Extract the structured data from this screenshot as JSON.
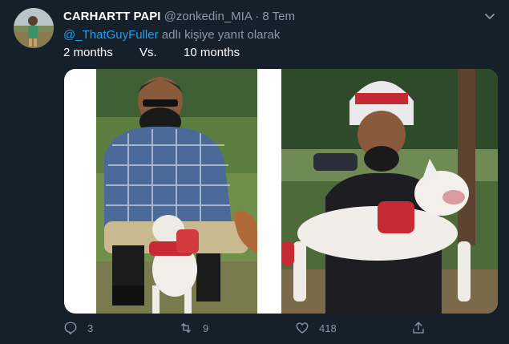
{
  "tweet": {
    "display_name": "CARHARTT PAPI",
    "handle": "@zonkedin_MIA",
    "separator": "·",
    "date": "8 Tem",
    "reply_to_handle": "@_ThatGuyFuller",
    "reply_to_suffix": " adlı kişiye yanıt olarak",
    "text": "2 months        Vs.        10 months"
  },
  "actions": {
    "reply_count": "3",
    "retweet_count": "9",
    "like_count": "418"
  },
  "icons": {
    "reply": "reply-icon",
    "retweet": "retweet-icon",
    "like": "heart-icon",
    "share": "share-icon",
    "more": "chevron-down-icon"
  },
  "colors": {
    "background": "#15202b",
    "secondary_text": "#8899a6",
    "link": "#1da1f2"
  }
}
